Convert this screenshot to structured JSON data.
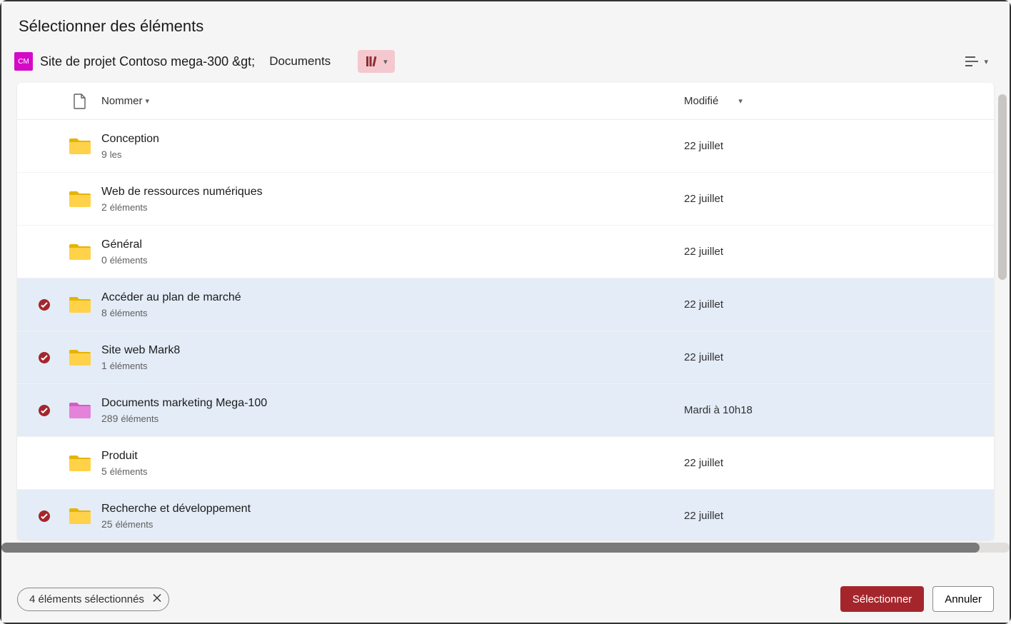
{
  "dialog": {
    "title": "Sélectionner des éléments"
  },
  "breadcrumb": {
    "siteIconText": "CM",
    "siteName": "Site de projet Contoso mega-300 &gt;",
    "location": "Documents"
  },
  "columns": {
    "name": "Nommer",
    "modified": "Modifié"
  },
  "items": [
    {
      "name": "Conception",
      "count": "9",
      "unit": "les",
      "modified": "22 juillet",
      "selected": false,
      "color": "yellow"
    },
    {
      "name": "Web de ressources numériques",
      "count": "2",
      "unit": "éléments",
      "modified": "22 juillet",
      "selected": false,
      "color": "yellow"
    },
    {
      "name": "Général",
      "count": "0",
      "unit": "éléments",
      "modified": "22 juillet",
      "selected": false,
      "color": "yellow"
    },
    {
      "name": "Accéder au plan de marché",
      "count": "8",
      "unit": "éléments",
      "modified": "22 juillet",
      "selected": true,
      "color": "yellow"
    },
    {
      "name": "Site web Mark8",
      "count": "1",
      "unit": "éléments",
      "modified": "22 juillet",
      "selected": true,
      "color": "yellow"
    },
    {
      "name": "Documents marketing Mega-100",
      "count": "289",
      "unit": "éléments",
      "modified": "Mardi à 10h18",
      "selected": true,
      "color": "pink"
    },
    {
      "name": "Produit",
      "count": "5",
      "unit": "éléments",
      "modified": "22 juillet",
      "selected": false,
      "color": "yellow"
    },
    {
      "name": "Recherche et développement",
      "count": "25",
      "unit": "éléments",
      "modified": "22 juillet",
      "selected": true,
      "color": "yellow"
    }
  ],
  "footer": {
    "selectionSummary": "4 éléments sélectionnés",
    "selectLabel": "Sélectionner",
    "cancelLabel": "Annuler"
  }
}
